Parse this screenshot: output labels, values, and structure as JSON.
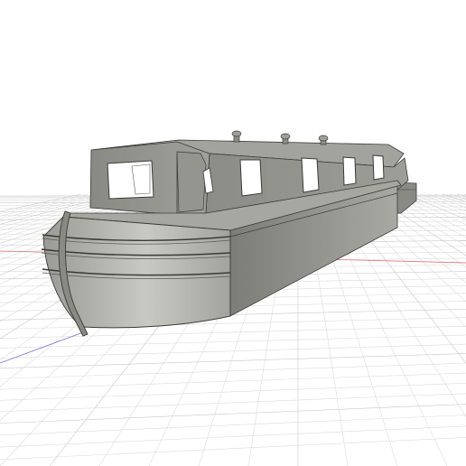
{
  "viewport": {
    "background": "#ffffff",
    "grid_color": "#dcdcdc",
    "grid_major_color": "#c8c8c8",
    "x_axis_color": "#e07070",
    "y_axis_color": "#7070d0",
    "grid_visible": true
  },
  "model": {
    "subject": "narrowboat",
    "body_color": "#8e8e88",
    "body_light_color": "#b8b8b2",
    "body_dark_color": "#6f6f6a",
    "roof_color": "#a2a29c",
    "outline_color": "#3a3a38",
    "window_color": "#ffffff",
    "window_count_side": 4,
    "roof_vent_count": 3,
    "hull_rubbing_strake_count": 3,
    "has_rudder_post": true
  }
}
